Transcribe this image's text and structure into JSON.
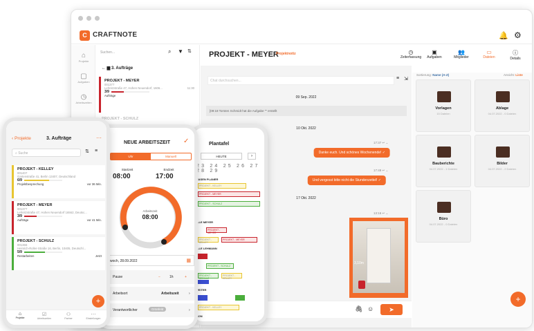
{
  "app": {
    "brand": "CRAFTNOTE"
  },
  "sidebar": {
    "items": [
      {
        "label": "Projekte"
      },
      {
        "label": "Aufgaben"
      },
      {
        "label": "Arbeitszeiten"
      }
    ]
  },
  "list": {
    "search_placeholder": "Suchen...",
    "breadcrumb": "3. Aufträge",
    "project": {
      "name": "PROJEKT - MEYER",
      "id": "001377",
      "address": "Lehnitzstraße 47, Hohen Neuendorf, 1606...",
      "progress": "3/9",
      "time": "11:30",
      "tag": "Aufträge",
      "progress_value": 0.33
    },
    "next": "PROJEKT - SCHULZ"
  },
  "chat": {
    "title": "PROJEKT - MEYER",
    "subtitle": "Projektnotiz",
    "search_placeholder": "Chat durchsuchen...",
    "date1": "09 Sep. 2022",
    "system_msg": "[09:18 Torsten Schmidt hat die Aufgabe \"\" erstellt",
    "date2": "10 Okt. 2022",
    "meta1": "17:37",
    "msg1": "Danke euch. Und schönes Wochenende! ✓",
    "meta2": "17:49",
    "msg2": "Und vergesst bitte nicht die Stundenzettel! ✓",
    "date3": "17 Okt. 2022",
    "meta3": "13:16",
    "photo_caption": "3,10m"
  },
  "tabs": [
    {
      "label": "Zeiterfassung",
      "icon": "clock-icon"
    },
    {
      "label": "Aufgaben",
      "icon": "clipboard-icon"
    },
    {
      "label": "Mitglieder",
      "icon": "people-icon"
    },
    {
      "label": "Dateien",
      "icon": "folder-icon",
      "active": true
    },
    {
      "label": "Details",
      "icon": "info-icon"
    }
  ],
  "files": {
    "sort_label": "Sortierung:",
    "sort_value": "Name (A-Z)",
    "view_label": "Ansicht:",
    "view_value": "Liste",
    "folders": [
      {
        "name": "Vorlagen",
        "sub": "15 Dateien"
      },
      {
        "name": "Ablage",
        "sub": "04.07.2022 - 0 Dateien"
      },
      {
        "name": "Bauberichte",
        "sub": "04.07.2022 - 1 Dateien"
      },
      {
        "name": "Bilder",
        "sub": "04.07.2022 - 2 Dateien"
      },
      {
        "name": "Büro",
        "sub": "04.07.2022 - 0 Dateien"
      }
    ]
  },
  "phone1": {
    "back": "Projekte",
    "title": "3. Aufträge",
    "search_placeholder": "Suche",
    "projects": [
      {
        "name": "PROJEKT - KELLEY",
        "id": "001407",
        "addr": "Gartenstraße 41, Berlin 13407, Deutschland",
        "progress": "6/9",
        "tag": "Projektbesprechung",
        "time": "vor 36 Min.",
        "color": "#e8c531",
        "progress_value": 0.66
      },
      {
        "name": "PROJEKT - MEYER",
        "id": "001377",
        "addr": "Lehnitzstraße 47, Hohen Neuendorf 16562, Deutsc...",
        "progress": "3/9",
        "tag": "Aufträge",
        "time": "vor 41 Min.",
        "color": "#c8232c",
        "progress_value": 0.33
      },
      {
        "name": "PROJEKT - SCHULZ",
        "id": "001366",
        "addr": "Heinrich-Roller-Straße 16, Berlin, 10405, Deutschl...",
        "progress": "5/9",
        "tag": "Restarbeiten",
        "time": "Jetzt",
        "color": "#4bae3c",
        "progress_value": 0.55
      }
    ],
    "nav": [
      "Projekte",
      "Arbeitszeiten",
      "Partner",
      "Einstellungen"
    ]
  },
  "phone2": {
    "title": "NEUE ARBEITSZEIT",
    "toggle_on": "Uhr",
    "toggle_off": "Manuell",
    "start_label": "Startzeit",
    "start": "08:00",
    "end_label": "Endzeit",
    "end": "17:00",
    "clock_label": "Arbeitszeit",
    "clock_value": "08:00",
    "date": "woch, 28.09.2022",
    "pause_label": "Pause",
    "pause_value": "1h",
    "ort_label": "Arbeitsort",
    "ort_value": "Arbeitszeit",
    "verantw_label": "Verantwortlicher",
    "verantw_value": "Grünfeld"
  },
  "phone3": {
    "title": "Plantafel",
    "today": "HEUTE",
    "days": [
      "23",
      "24",
      "25",
      "26",
      "27",
      "28",
      "29"
    ],
    "sections": [
      "EASEN PLANER",
      "ILLE MEYER",
      "ILLE LEHMANN",
      "PEITER",
      "SON"
    ],
    "bars": [
      "PROJEKT - KELLEY",
      "PROJEKT - MEYER",
      "PROJEKT - SCHULZ"
    ]
  }
}
